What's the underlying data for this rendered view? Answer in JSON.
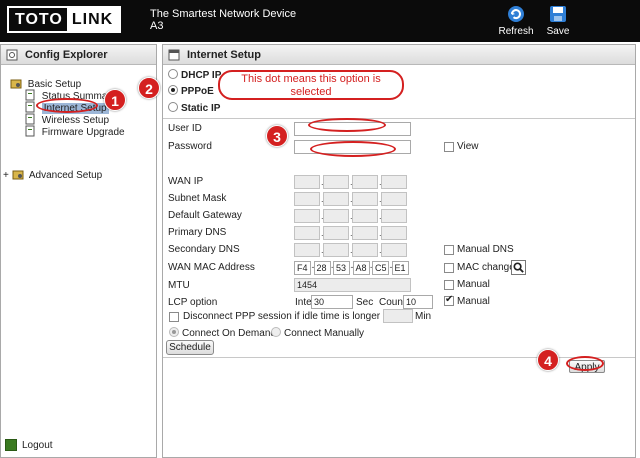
{
  "header": {
    "logo_left": "TOTO",
    "logo_right": "LINK",
    "tagline": "The Smartest Network Device",
    "model": "A3",
    "refresh_label": "Refresh",
    "save_label": "Save"
  },
  "left_panel": {
    "title": "Config Explorer",
    "basic_setup": "Basic Setup",
    "items": [
      "Status Summary",
      "Internet Setup",
      "Wireless Setup",
      "Firmware Upgrade"
    ],
    "advanced_setup": "Advanced Setup",
    "logout": "Logout"
  },
  "right_panel": {
    "title": "Internet Setup",
    "connection_types": [
      "DHCP IP",
      "PPPoE",
      "Static IP"
    ],
    "selected_type": "PPPoE",
    "user_id_label": "User ID",
    "password_label": "Password",
    "view_label": "View",
    "wan_ip_label": "WAN IP",
    "subnet_mask_label": "Subnet Mask",
    "default_gateway_label": "Default Gateway",
    "primary_dns_label": "Primary DNS",
    "secondary_dns_label": "Secondary DNS",
    "manual_dns_label": "Manual DNS",
    "wan_mac_label": "WAN MAC Address",
    "mac_octets": [
      "F4",
      "28",
      "53",
      "A8",
      "C5",
      "E1"
    ],
    "mac_change_label": "MAC change",
    "mtu_label": "MTU",
    "mtu_value": "1454",
    "mtu_manual_label": "Manual",
    "lcp_label": "LCP option",
    "interval_label": "Interval",
    "interval_value": "30",
    "sec_label": "Sec",
    "count_label": "Count",
    "count_value": "10",
    "lcp_manual_label": "Manual",
    "disconnect_label": "Disconnect PPP session if idle time is longer than",
    "min_label": "Min",
    "connect_on_demand": "Connect On Demand",
    "connect_manually": "Connect Manually",
    "schedule_label": "Schedule",
    "apply_label": "Apply"
  },
  "annotations": {
    "step1": "1",
    "step2": "2",
    "step3": "3",
    "step4": "4",
    "callout": "This dot means this option is selected"
  },
  "colors": {
    "header_bg": "#0b0b0b",
    "annotation_red": "#d42020",
    "selected_item_bg": "#9db7d8"
  }
}
